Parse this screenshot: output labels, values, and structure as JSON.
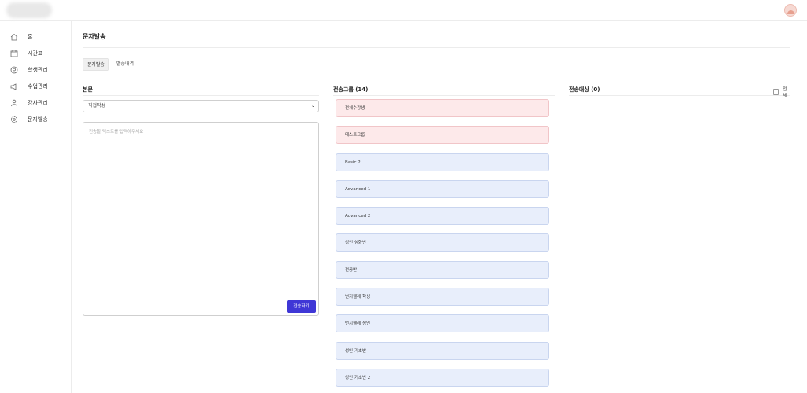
{
  "header": {
    "logo_icon": "blurred-logo",
    "avatar_icon": "user-avatar-icon"
  },
  "sidebar": {
    "items": [
      {
        "label": "홈",
        "icon": "home-icon"
      },
      {
        "label": "시간표",
        "icon": "calendar-icon"
      },
      {
        "label": "학생관리",
        "icon": "student-icon"
      },
      {
        "label": "수업관리",
        "icon": "class-icon"
      },
      {
        "label": "강사관리",
        "icon": "teacher-icon"
      },
      {
        "label": "문자발송",
        "icon": "settings-icon"
      }
    ]
  },
  "main": {
    "title": "문자발송",
    "tabs": [
      {
        "label": "문자발송",
        "active": true
      },
      {
        "label": "발송내역",
        "active": false
      }
    ],
    "body_section": {
      "title": "본문",
      "select_value": "직접작성",
      "textarea_placeholder": "전송할 텍스트를 입력해주세요",
      "send_label": "전송하기"
    },
    "group_section": {
      "title": "전송그룹 (14)",
      "groups": [
        {
          "label": "전체수강생",
          "color": "pink"
        },
        {
          "label": "테스트그룹",
          "color": "pink"
        },
        {
          "label": "Basic 2",
          "color": "blue"
        },
        {
          "label": "Advanced 1",
          "color": "blue"
        },
        {
          "label": "Advanced 2",
          "color": "blue"
        },
        {
          "label": "성인 심화반",
          "color": "blue"
        },
        {
          "label": "전공반",
          "color": "blue"
        },
        {
          "label": "번지웰레 학생",
          "color": "blue"
        },
        {
          "label": "번지웰레 성인",
          "color": "blue"
        },
        {
          "label": "성인 기초반",
          "color": "blue"
        },
        {
          "label": "성인 기초반 2",
          "color": "blue"
        }
      ]
    },
    "target_section": {
      "title": "전송대상 (0)",
      "all_label": "전체"
    }
  },
  "colors": {
    "accent": "#3f37d6",
    "pink_bg": "#fde9ea",
    "blue_bg": "#e8eefb"
  }
}
